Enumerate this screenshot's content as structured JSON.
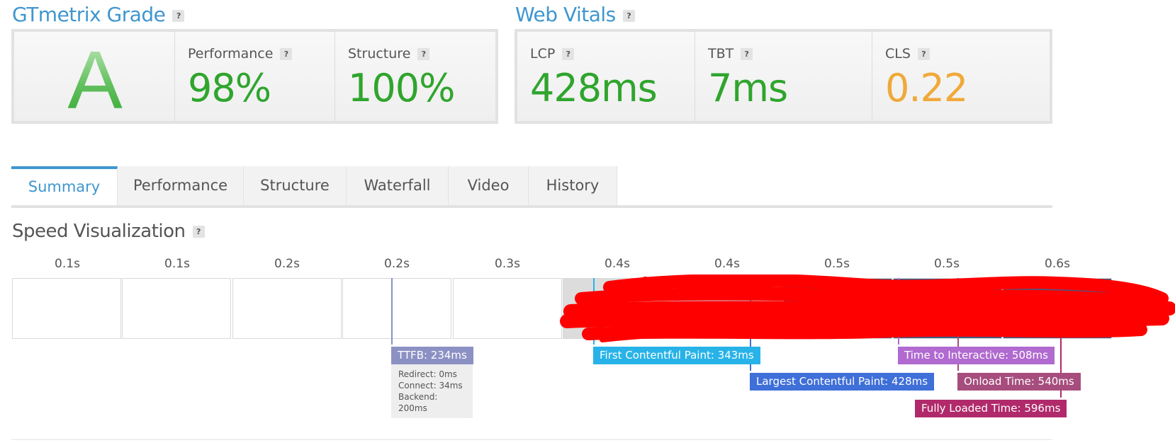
{
  "grade": {
    "title": "GTmetrix Grade",
    "help": "?",
    "letter": "A",
    "performance": {
      "label": "Performance",
      "help": "?",
      "value": "98%"
    },
    "structure": {
      "label": "Structure",
      "help": "?",
      "value": "100%"
    }
  },
  "vitals": {
    "title": "Web Vitals",
    "help": "?",
    "lcp": {
      "label": "LCP",
      "help": "?",
      "value": "428ms"
    },
    "tbt": {
      "label": "TBT",
      "help": "?",
      "value": "7ms"
    },
    "cls": {
      "label": "CLS",
      "help": "?",
      "value": "0.22"
    }
  },
  "tabs": [
    "Summary",
    "Performance",
    "Structure",
    "Waterfall",
    "Video",
    "History"
  ],
  "speed": {
    "title": "Speed Visualization",
    "help": "?",
    "ticks": [
      "0.1s",
      "0.1s",
      "0.2s",
      "0.2s",
      "0.3s",
      "0.4s",
      "0.4s",
      "0.5s",
      "0.5s",
      "0.6s"
    ],
    "ttfb": {
      "label": "TTFB: 234ms",
      "redirect": "Redirect: 0ms",
      "connect": "Connect: 34ms",
      "backend": "Backend: 200ms"
    },
    "fcp": "First Contentful Paint: 343ms",
    "lcp": "Largest Contentful Paint: 428ms",
    "tti": "Time to Interactive: 508ms",
    "onload": "Onload Time: 540ms",
    "fully": "Fully Loaded Time: 596ms"
  },
  "colors": {
    "accent": "#3f96cf",
    "good": "#2fa52d",
    "warn": "#f0a93a",
    "ttfb": "#8c91c4",
    "fcp": "#28b3e8",
    "lcp": "#3f6fd8",
    "tti": "#b06ad0",
    "onload": "#a64d7d",
    "fully": "#b02a6b",
    "redaction": "#ff0000"
  }
}
